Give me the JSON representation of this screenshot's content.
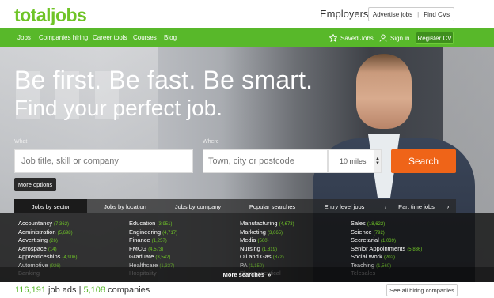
{
  "header": {
    "logo": "totaljobs",
    "employers_label": "Employers",
    "advertise_jobs": "Advertise jobs",
    "divider": "|",
    "find_cvs": "Find CVs"
  },
  "nav": {
    "items": [
      "Jobs",
      "Companies hiring",
      "Career tools",
      "Courses",
      "Blog"
    ],
    "saved_jobs": "Saved Jobs",
    "sign_in": "Sign in",
    "register_cv": "Register CV"
  },
  "hero": {
    "headline": "Be first. Be fast. Be smart.",
    "subline": "Find your perfect job.",
    "what_label": "What",
    "what_placeholder": "Job title, skill or company",
    "where_label": "Where",
    "where_placeholder": "Town, city or postcode",
    "radius": "10 miles",
    "search_button": "Search",
    "more_options": "More options"
  },
  "tabs": {
    "items": [
      "Jobs by sector",
      "Jobs by location",
      "Jobs by company",
      "Popular searches",
      "Entry level jobs",
      "Part time jobs"
    ],
    "active": "Jobs by sector"
  },
  "sectors": {
    "columns": [
      [
        {
          "name": "Accountancy",
          "count": "(7,362)"
        },
        {
          "name": "Administration",
          "count": "(5,698)"
        },
        {
          "name": "Advertising",
          "count": "(26)"
        },
        {
          "name": "Aerospace",
          "count": "(14)"
        },
        {
          "name": "Apprenticeships",
          "count": "(4,906)"
        },
        {
          "name": "Automotive",
          "count": "(926)"
        },
        {
          "name": "Banking",
          "count": ""
        }
      ],
      [
        {
          "name": "Education",
          "count": "(3,951)"
        },
        {
          "name": "Engineering",
          "count": "(4,717)"
        },
        {
          "name": "Finance",
          "count": "(1,257)"
        },
        {
          "name": "FMCG",
          "count": "(4,573)"
        },
        {
          "name": "Graduate",
          "count": "(3,542)"
        },
        {
          "name": "Healthcare",
          "count": "(1,337)"
        },
        {
          "name": "Hospitality",
          "count": ""
        }
      ],
      [
        {
          "name": "Manufacturing",
          "count": "(4,673)"
        },
        {
          "name": "Marketing",
          "count": "(3,665)"
        },
        {
          "name": "Media",
          "count": "(560)"
        },
        {
          "name": "Nursing",
          "count": "(1,819)"
        },
        {
          "name": "Oil and Gas",
          "count": "(872)"
        },
        {
          "name": "PA",
          "count": "(1,150)"
        },
        {
          "name": "Pharmaceutical",
          "count": ""
        }
      ],
      [
        {
          "name": "Sales",
          "count": "(18,622)"
        },
        {
          "name": "Science",
          "count": "(792)"
        },
        {
          "name": "Secretarial",
          "count": "(1,039)"
        },
        {
          "name": "Senior Appointments",
          "count": "(5,836)"
        },
        {
          "name": "Social Work",
          "count": "(202)"
        },
        {
          "name": "Teaching",
          "count": "(1,560)"
        },
        {
          "name": "Telesales",
          "count": ""
        }
      ]
    ],
    "more_searches": "More searches"
  },
  "footer_stats": {
    "job_ads_count": "116,191",
    "job_ads_label": "job ads",
    "divider": "|",
    "companies_count": "5,108",
    "companies_label": "companies",
    "see_all": "See all hiring companies"
  },
  "colors": {
    "brand_green": "#58b82a",
    "search_orange": "#ef6418"
  }
}
